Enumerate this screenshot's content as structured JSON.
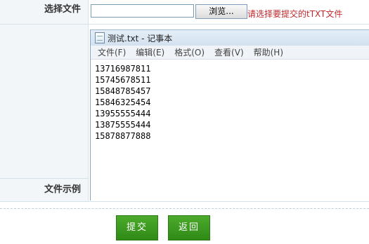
{
  "form": {
    "file_label": "选择文件",
    "browse_label": "浏览...",
    "hint": "请选择要提交的tTXT文件",
    "example_label": "文件示例"
  },
  "notepad": {
    "title": "测试.txt - 记事本",
    "menu": [
      "文件(F)",
      "编辑(E)",
      "格式(O)",
      "查看(V)",
      "帮助(H)"
    ],
    "lines": [
      "13716987811",
      "15745678511",
      "15848785457",
      "15846325454",
      "13955555444",
      "13875555444",
      "15878877888"
    ]
  },
  "actions": {
    "submit": "提交",
    "back": "返回"
  }
}
